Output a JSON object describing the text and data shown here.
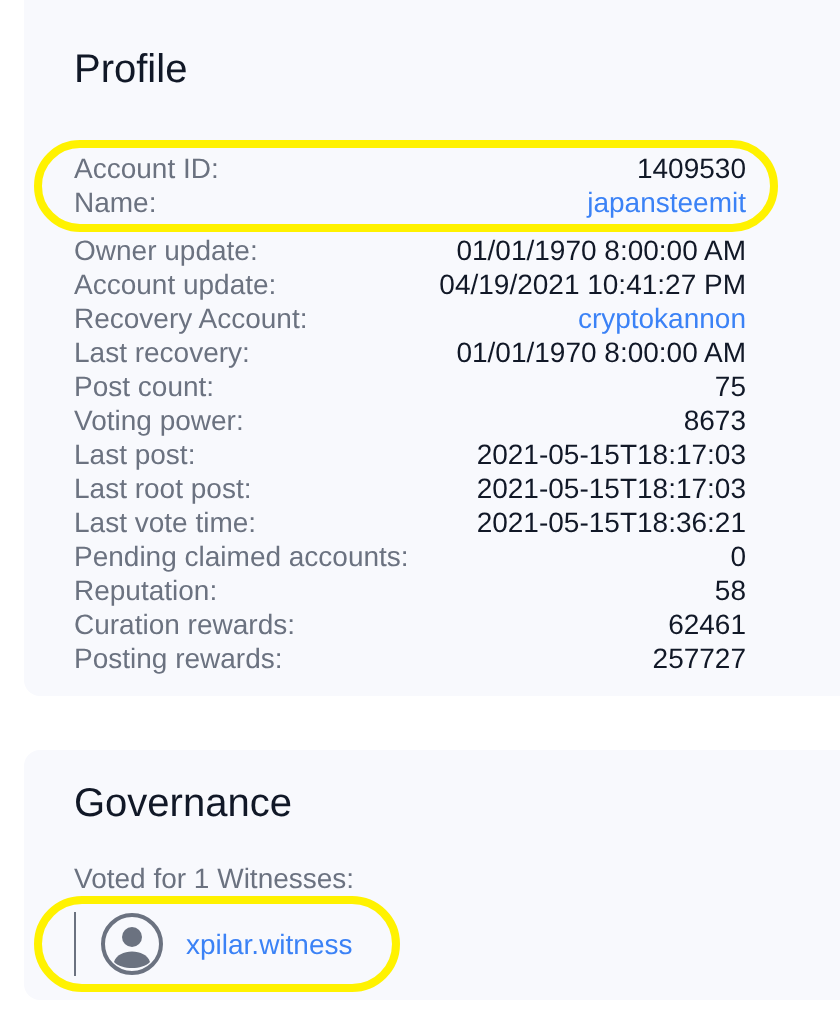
{
  "profile": {
    "title": "Profile",
    "fields": [
      {
        "label": "Account ID:",
        "value": "1409530",
        "kind": "text",
        "circled": true
      },
      {
        "label": "Name:",
        "value": "japansteemit",
        "kind": "link",
        "circled": true
      },
      {
        "label": "Owner update:",
        "value": "01/01/1970 8:00:00 AM",
        "kind": "text",
        "circled": false
      },
      {
        "label": "Account update:",
        "value": "04/19/2021 10:41:27 PM",
        "kind": "text",
        "circled": false
      },
      {
        "label": "Recovery Account:",
        "value": "cryptokannon",
        "kind": "link",
        "circled": false
      },
      {
        "label": "Last recovery:",
        "value": "01/01/1970 8:00:00 AM",
        "kind": "text",
        "circled": false
      },
      {
        "label": "Post count:",
        "value": "75",
        "kind": "text",
        "circled": false
      },
      {
        "label": "Voting power:",
        "value": "8673",
        "kind": "text",
        "circled": false
      },
      {
        "label": "Last post:",
        "value": "2021-05-15T18:17:03",
        "kind": "text",
        "circled": false
      },
      {
        "label": "Last root post:",
        "value": "2021-05-15T18:17:03",
        "kind": "text",
        "circled": false
      },
      {
        "label": "Last vote time:",
        "value": "2021-05-15T18:36:21",
        "kind": "text",
        "circled": false
      },
      {
        "label": "Pending claimed accounts:",
        "value": "0",
        "kind": "text",
        "circled": false
      },
      {
        "label": "Reputation:",
        "value": "58",
        "kind": "text",
        "circled": false
      },
      {
        "label": "Curation rewards:",
        "value": "62461",
        "kind": "text",
        "circled": false
      },
      {
        "label": "Posting rewards:",
        "value": "257727",
        "kind": "text",
        "circled": false
      }
    ]
  },
  "governance": {
    "title": "Governance",
    "voted_label": "Voted for 1 Witnesses:",
    "witnesses": [
      {
        "name": "xpilar.witness",
        "circled": true
      }
    ]
  }
}
